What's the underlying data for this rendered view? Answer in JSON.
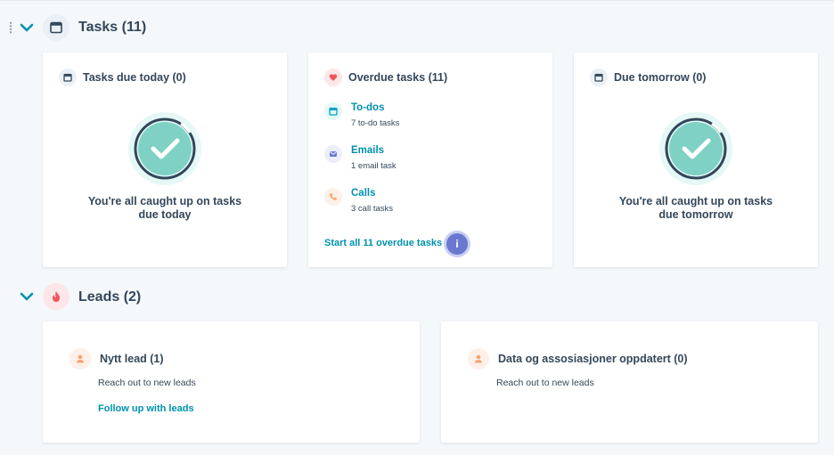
{
  "tasks_section": {
    "title": "Tasks (11)",
    "cards": {
      "due_today": {
        "title": "Tasks due today (0)",
        "empty_line1": "You're all caught up on tasks",
        "empty_line2": "due today"
      },
      "overdue": {
        "title": "Overdue tasks (11)",
        "items": [
          {
            "label": "To-dos",
            "sub": "7 to-do tasks",
            "icon": "todo-icon",
            "color": "#00bda5"
          },
          {
            "label": "Emails",
            "sub": "1 email task",
            "icon": "email-icon",
            "color": "#6a78d1"
          },
          {
            "label": "Calls",
            "sub": "3 call tasks",
            "icon": "phone-icon",
            "color": "#f5a26f"
          }
        ],
        "start_link": "Start all 11 overdue tasks",
        "info_label": "i"
      },
      "due_tomorrow": {
        "title": "Due tomorrow (0)",
        "empty_line1": "You're all caught up on tasks",
        "empty_line2": "due tomorrow"
      }
    }
  },
  "leads_section": {
    "title": "Leads (2)",
    "cards": {
      "new_lead": {
        "title": "Nytt lead (1)",
        "description": "Reach out to new leads",
        "link": "Follow up with leads"
      },
      "data_updated": {
        "title": "Data og assosiasjoner oppdatert (0)",
        "description": "Reach out to new leads"
      }
    }
  },
  "colors": {
    "link": "#0091ae",
    "text": "#33475b",
    "accent_teal": "#00bda5",
    "accent_purple": "#6a78d1",
    "leads_red": "#f2545b"
  }
}
